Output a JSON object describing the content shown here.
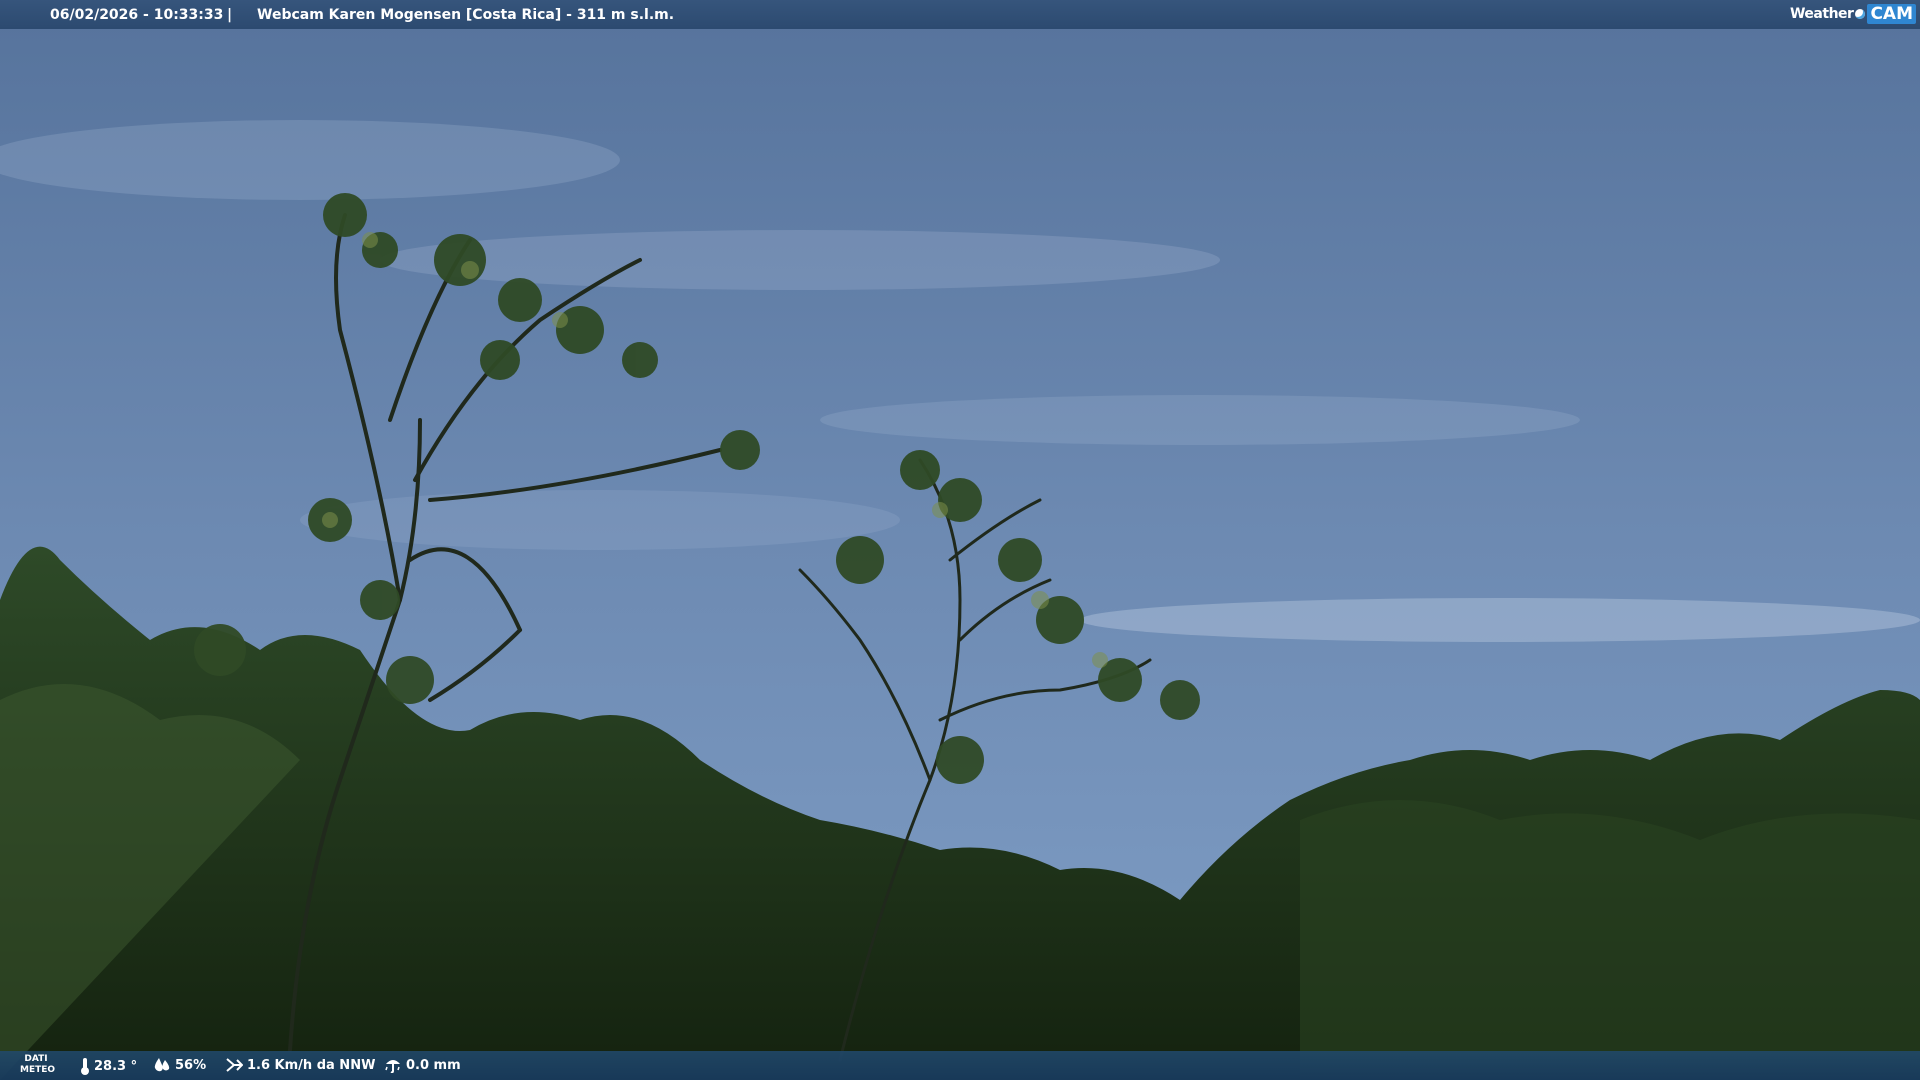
{
  "header": {
    "datetime": "06/02/2026 - 10:33:33",
    "separator": "|",
    "location": "Webcam Karen Mogensen [Costa Rica] - 311 m s.l.m."
  },
  "brand": {
    "weather": "Weather",
    "cam": "CAM"
  },
  "footer": {
    "label_line1": "DATI",
    "label_line2": "METEO",
    "temperature": "28.3 °",
    "humidity": "56%",
    "wind": "1.6 Km/h da NNW",
    "rain": "0.0 mm"
  },
  "icons": {
    "temperature": "thermometer-icon",
    "humidity": "humidity-drop-icon",
    "wind": "wind-icon",
    "rain": "rain-gauge-icon"
  },
  "colors": {
    "bar": "#2c4a70",
    "brand_accent": "#2f86d1"
  }
}
